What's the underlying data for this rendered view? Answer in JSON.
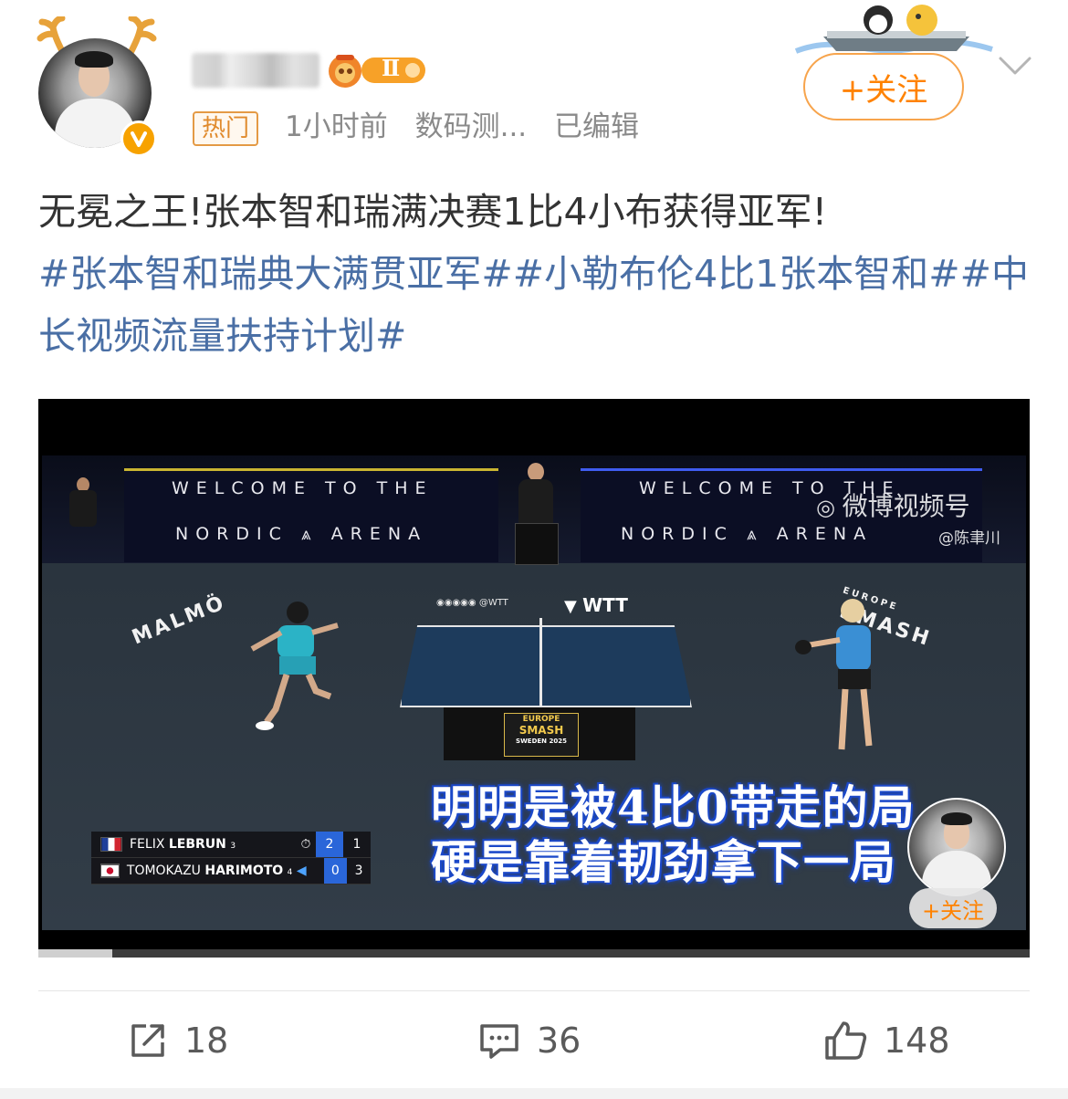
{
  "post": {
    "hot_tag": "热门",
    "time": "1小时前",
    "source": "数码测...",
    "edited": "已编辑",
    "follow_label": "+关注",
    "level_badge_text": "Ⅱ",
    "title_line": "无冕之王!张本智和瑞满决赛1比4小布获得亚军!",
    "hashtags": [
      "#张本智和瑞典大满贯亚军#",
      "#小勒布伦4比1张本智和#",
      "#中长视频流量扶持计划#"
    ]
  },
  "video": {
    "banner_left_top": "WELCOME TO THE",
    "banner_left_bottom": "NORDIC ⩓ ARENA",
    "banner_right_top": "WELCOME TO THE",
    "banner_right_bottom": "NORDIC ⩓ ARENA",
    "court_left": "MALMÖ",
    "court_right_small": "EUROPE",
    "court_right": "SMASH",
    "wtt_social": "@WTT",
    "wtt_logo": "WTT",
    "table_sign_1": "EUROPE",
    "table_sign_2": "SMASH",
    "table_sign_3": "SWEDEN 2025",
    "watermark_main": "微博视频号",
    "watermark_sub": "@陈聿川",
    "score": [
      {
        "first": "FELIX",
        "last": "LEBRUN",
        "seed": "3",
        "serve": "",
        "games": "2",
        "points": "1",
        "flag_colors": [
          "#1f3f99",
          "#ffffff",
          "#d22630"
        ]
      },
      {
        "first": "TOMOKAZU",
        "last": "HARIMOTO",
        "seed": "4",
        "serve": "◀",
        "games": "0",
        "points": "3",
        "flag_colors": [
          "#ffffff",
          "#c8102e"
        ]
      }
    ],
    "subtitle_line1": "明明是被4比0带走的局",
    "subtitle_line2": "硬是靠着韧劲拿下一局",
    "mini_follow": "+关注",
    "progress_fraction": 0.075
  },
  "actions": {
    "repost_count": "18",
    "comment_count": "36",
    "like_count": "148"
  },
  "colors": {
    "accent": "#ff8200",
    "hashtag": "#4a6fa5",
    "meta": "#8a8a8a"
  }
}
